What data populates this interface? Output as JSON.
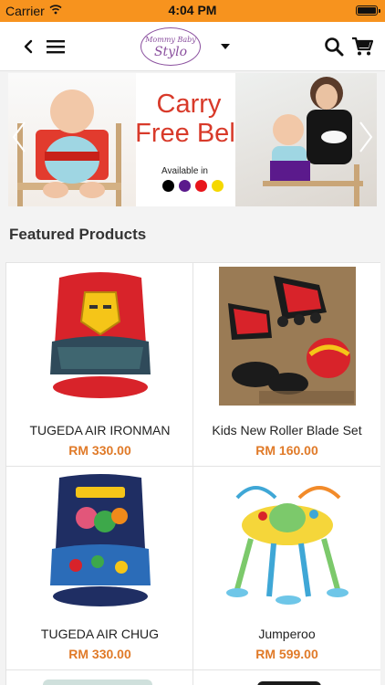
{
  "status_bar": {
    "carrier": "Carrier",
    "time": "4:04 PM"
  },
  "nav": {
    "logo_line1": "Mommy Baby",
    "logo_line2": "Stylo",
    "icons": [
      "chevron-left-icon",
      "hamburger-menu-icon",
      "dropdown-caret-icon",
      "search-icon",
      "cart-icon"
    ]
  },
  "banner": {
    "headline": "Carry Free Belt",
    "available_label": "Available in",
    "color_dots": [
      "#000000",
      "#5b1a8c",
      "#e8151b",
      "#f5d800"
    ]
  },
  "featured": {
    "title": "Featured Products",
    "products": [
      {
        "name": "TUGEDA AIR IRONMAN",
        "price": "RM 330.00"
      },
      {
        "name": "Kids New Roller Blade Set",
        "price": "RM 160.00"
      },
      {
        "name": "TUGEDA AIR CHUG",
        "price": "RM 330.00"
      },
      {
        "name": "Jumperoo",
        "price": "RM 599.00"
      }
    ]
  },
  "colors": {
    "status_bar": "#f7931e",
    "price": "#e07a28",
    "logo": "#8a4f9e",
    "headline": "#d83a2a"
  }
}
